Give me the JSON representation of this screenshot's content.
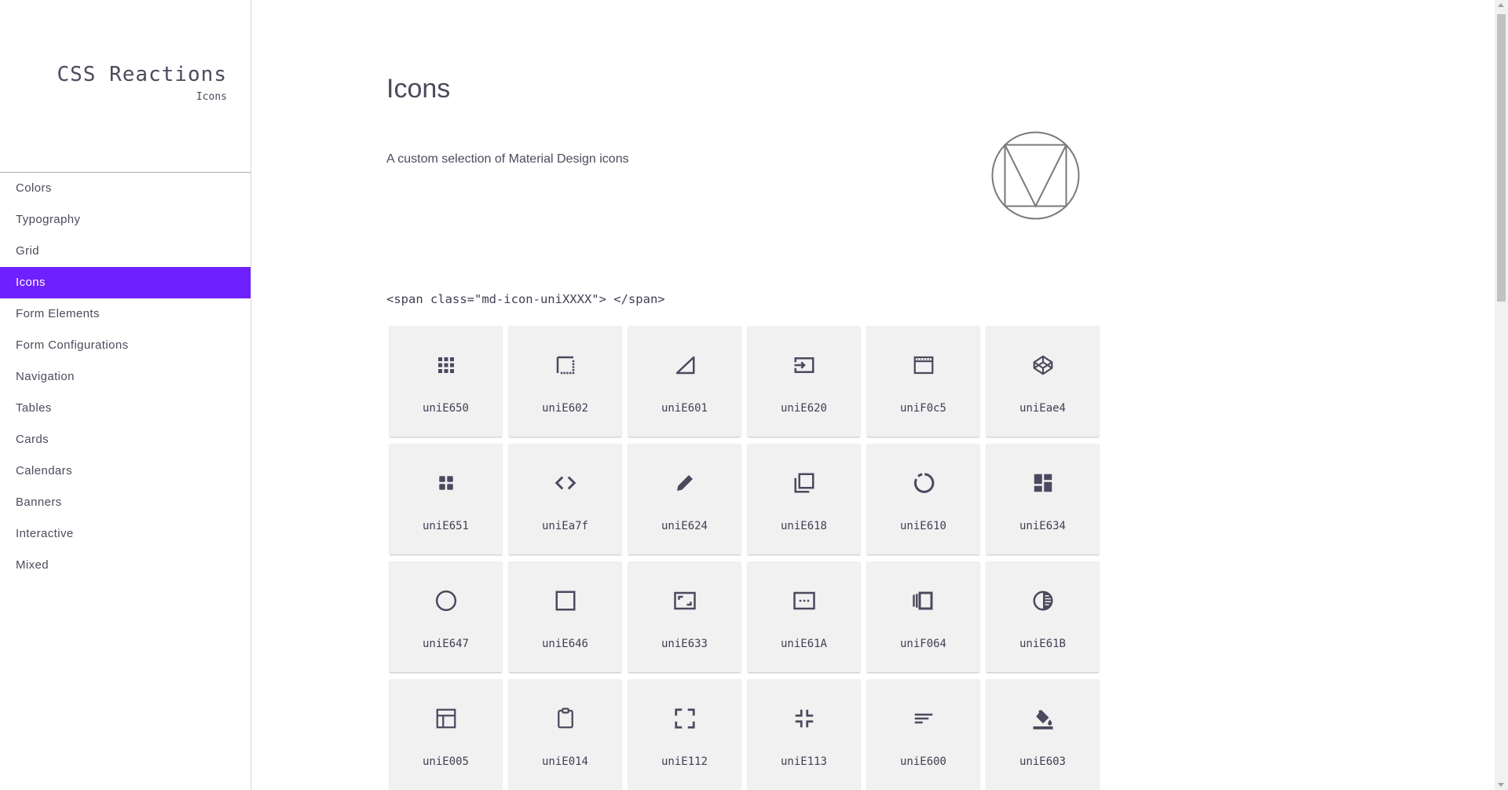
{
  "brand": {
    "title": "CSS Reactions",
    "subtitle": "Icons"
  },
  "nav": [
    {
      "label": "Colors"
    },
    {
      "label": "Typography"
    },
    {
      "label": "Grid"
    },
    {
      "label": "Icons",
      "active": true
    },
    {
      "label": "Form Elements"
    },
    {
      "label": "Form Configurations"
    },
    {
      "label": "Navigation"
    },
    {
      "label": "Tables"
    },
    {
      "label": "Cards"
    },
    {
      "label": "Calendars"
    },
    {
      "label": "Banners"
    },
    {
      "label": "Interactive"
    },
    {
      "label": "Mixed"
    }
  ],
  "accent_color": "#6e20ff",
  "main": {
    "title": "Icons",
    "description": "A custom selection of Material Design icons",
    "logo_icon": "material-design-logo-icon",
    "code_example": "<span class=\"md-icon-uniXXXX\"> </span>",
    "icons": [
      {
        "label": "uniE650",
        "icon": "apps-grid-icon"
      },
      {
        "label": "uniE602",
        "icon": "border-style-icon"
      },
      {
        "label": "uniE601",
        "icon": "signal-triangle-icon"
      },
      {
        "label": "uniE620",
        "icon": "input-icon"
      },
      {
        "label": "uniF0c5",
        "icon": "browser-window-icon"
      },
      {
        "label": "uniEae4",
        "icon": "codepen-icon"
      },
      {
        "label": "uniE651",
        "icon": "view-module-icon"
      },
      {
        "label": "uniEa7f",
        "icon": "code-icon"
      },
      {
        "label": "uniE624",
        "icon": "pencil-icon"
      },
      {
        "label": "uniE618",
        "icon": "library-icon"
      },
      {
        "label": "uniE610",
        "icon": "loading-ring-icon"
      },
      {
        "label": "uniE634",
        "icon": "dashboard-icon"
      },
      {
        "label": "uniE647",
        "icon": "circle-outline-icon"
      },
      {
        "label": "uniE646",
        "icon": "square-outline-icon"
      },
      {
        "label": "uniE633",
        "icon": "aspect-ratio-icon"
      },
      {
        "label": "uniE61A",
        "icon": "dots-box-icon"
      },
      {
        "label": "uniF064",
        "icon": "view-carousel-icon"
      },
      {
        "label": "uniE61B",
        "icon": "contrast-icon"
      },
      {
        "label": "uniE005",
        "icon": "layout-icon"
      },
      {
        "label": "uniE014",
        "icon": "clipboard-icon"
      },
      {
        "label": "uniE112",
        "icon": "fullscreen-icon"
      },
      {
        "label": "uniE113",
        "icon": "fullscreen-exit-icon"
      },
      {
        "label": "uniE600",
        "icon": "short-text-icon"
      },
      {
        "label": "uniE603",
        "icon": "format-color-fill-icon"
      }
    ]
  }
}
